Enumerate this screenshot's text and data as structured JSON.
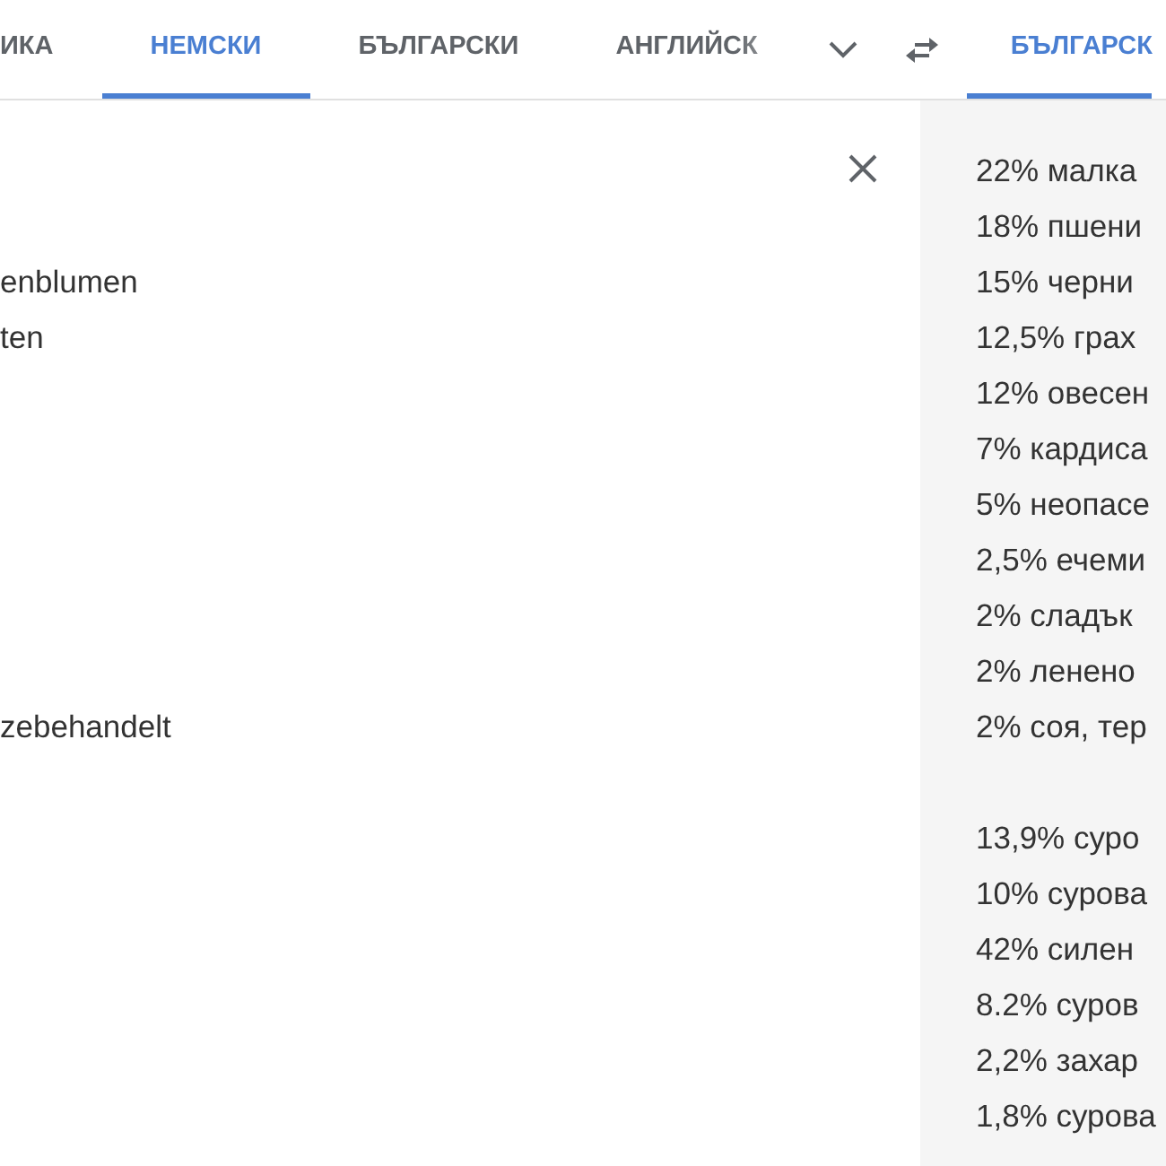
{
  "source_tabs": [
    {
      "label": "ИКА",
      "selected": false
    },
    {
      "label": "НЕМСКИ",
      "selected": true
    },
    {
      "label": "БЪЛГАРСКИ",
      "selected": false
    },
    {
      "label": "АНГЛИЙСК",
      "selected": false
    }
  ],
  "target_tabs": [
    {
      "label": "БЪЛГАРСК",
      "selected": true
    }
  ],
  "source_text": "\n\nenblumen\nten\n\n\n\n\n\n\nzebehandelt",
  "translation_groups": [
    [
      "22% малка",
      "18% пшени",
      "15% черни",
      "12,5% грах",
      "12% овесен",
      "7% кардиса",
      "5% неопасе",
      "2,5% ечеми",
      "2% сладък",
      "2% ленено",
      "2% соя, тер"
    ],
    [
      "13,9% суро",
      "10% сурова",
      "42% силен",
      "8.2% суров",
      "2,2% захар",
      "1,8% сурова"
    ]
  ]
}
